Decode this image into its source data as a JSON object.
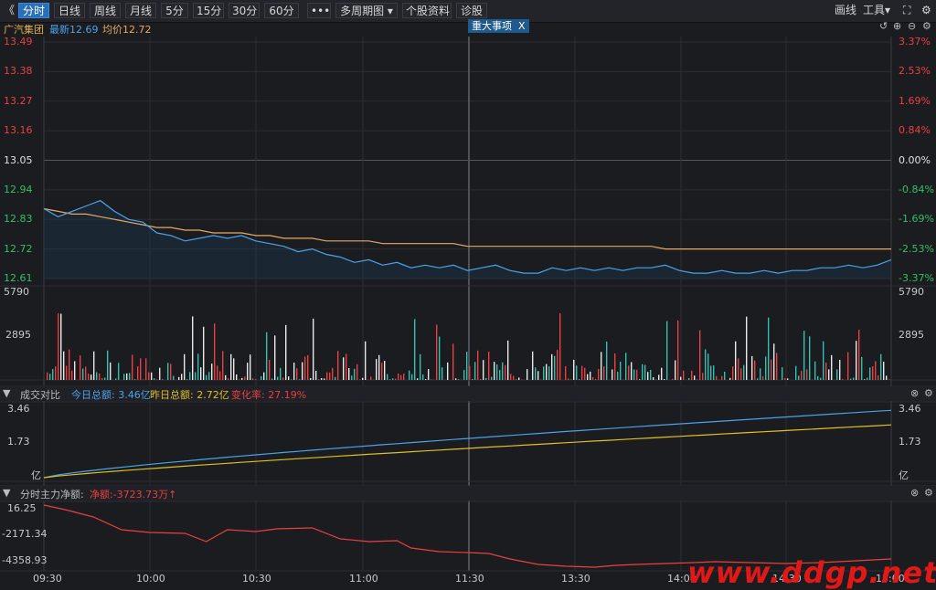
{
  "toolbar": {
    "back_icon": "double-left-chevron",
    "tabs": [
      "分时",
      "日线",
      "周线",
      "月线",
      "5分",
      "15分",
      "30分",
      "60分"
    ],
    "more_label": "•••",
    "multi_period_label": "多周期图",
    "stock_info_label": "个股资料",
    "diagnosis_label": "诊股",
    "draw_label": "画线",
    "tools_label": "工具",
    "fullscreen_icon": "expand-icon"
  },
  "quote": {
    "name": "广汽集团",
    "latest": "最新12.69",
    "avg": "均价12.72",
    "event_tag": "重大事项",
    "event_close": "X"
  },
  "price_axis": {
    "left": [
      "13.49",
      "13.38",
      "13.27",
      "13.16",
      "13.05",
      "12.94",
      "12.83",
      "12.72",
      "12.61"
    ],
    "right": [
      "3.37%",
      "2.53%",
      "1.69%",
      "0.84%",
      "0.00%",
      "-0.84%",
      "-1.69%",
      "-2.53%",
      "-3.37%"
    ]
  },
  "volume_axis": {
    "top": "5790",
    "mid": "2895"
  },
  "turnover_panel": {
    "title": "成交对比",
    "today": "今日总额: 3.46亿",
    "yesterday": "昨日总额: 2.72亿",
    "change": "变化率: 27.19%",
    "axis": [
      "3.46",
      "1.73",
      "亿"
    ]
  },
  "flow_panel": {
    "title": "分时主力净额:",
    "net": "净额:-3723.73万",
    "axis": [
      "16.25",
      "-2171.34",
      "-4358.93"
    ]
  },
  "time_axis": [
    "09:30",
    "10:00",
    "10:30",
    "11:00",
    "11:30",
    "13:30",
    "14:00",
    "14:30",
    "15:00"
  ],
  "watermark": "www.ddgp.net",
  "colors": {
    "up": "#e84040",
    "down": "#30c060",
    "price_line": "#4aa3e8",
    "avg_line": "#e8a860",
    "yesterday": "#e0c020"
  },
  "chart_data": [
    {
      "type": "line",
      "title": "",
      "ylim": [
        12.61,
        13.49
      ],
      "x": [
        0,
        4,
        8,
        12,
        16,
        20,
        24,
        28,
        32,
        36,
        40,
        44,
        48,
        52,
        56,
        60,
        64,
        68,
        72,
        76,
        80,
        84,
        88,
        92,
        96,
        100,
        104,
        108,
        112,
        116,
        120,
        124,
        128,
        132,
        136,
        140,
        144,
        148,
        152,
        156,
        160,
        164,
        168,
        172,
        176,
        180,
        184,
        188,
        192,
        196,
        200,
        204,
        208,
        212,
        216,
        220,
        224,
        228,
        232,
        236,
        240
      ],
      "series": [
        {
          "name": "最新",
          "values": [
            12.87,
            12.84,
            12.86,
            12.88,
            12.9,
            12.86,
            12.83,
            12.82,
            12.78,
            12.77,
            12.75,
            12.76,
            12.77,
            12.76,
            12.77,
            12.75,
            12.74,
            12.73,
            12.71,
            12.72,
            12.7,
            12.69,
            12.67,
            12.68,
            12.66,
            12.67,
            12.65,
            12.66,
            12.65,
            12.66,
            12.64,
            12.65,
            12.66,
            12.64,
            12.63,
            12.63,
            12.65,
            12.64,
            12.65,
            12.64,
            12.65,
            12.64,
            12.65,
            12.65,
            12.66,
            12.64,
            12.63,
            12.63,
            12.64,
            12.63,
            12.63,
            12.64,
            12.63,
            12.64,
            12.64,
            12.65,
            12.65,
            12.66,
            12.65,
            12.66,
            12.68
          ]
        },
        {
          "name": "均价",
          "values": [
            12.87,
            12.86,
            12.85,
            12.85,
            12.84,
            12.83,
            12.82,
            12.81,
            12.8,
            12.8,
            12.79,
            12.79,
            12.78,
            12.78,
            12.78,
            12.77,
            12.77,
            12.76,
            12.76,
            12.76,
            12.75,
            12.75,
            12.75,
            12.75,
            12.74,
            12.74,
            12.74,
            12.74,
            12.74,
            12.74,
            12.73,
            12.73,
            12.73,
            12.73,
            12.73,
            12.73,
            12.73,
            12.73,
            12.73,
            12.73,
            12.73,
            12.73,
            12.73,
            12.73,
            12.72,
            12.72,
            12.72,
            12.72,
            12.72,
            12.72,
            12.72,
            12.72,
            12.72,
            12.72,
            12.72,
            12.72,
            12.72,
            12.72,
            12.72,
            12.72,
            12.72
          ]
        }
      ]
    }
  ]
}
